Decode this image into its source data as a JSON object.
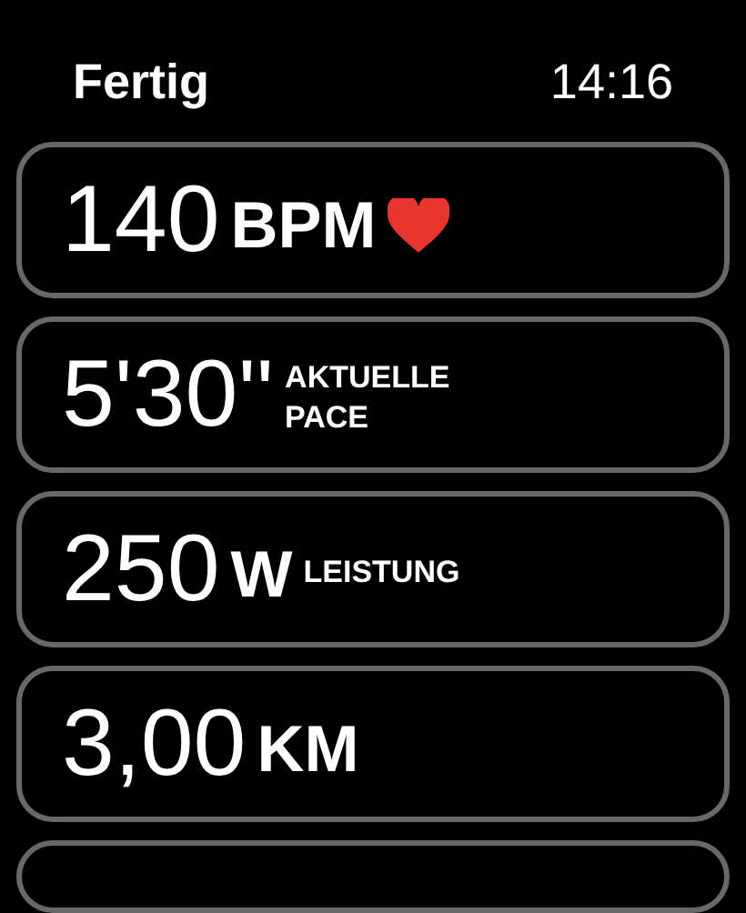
{
  "header": {
    "title": "Fertig",
    "time": "14:16"
  },
  "metrics": [
    {
      "kind": "heart",
      "value": "140",
      "unit": "BPM"
    },
    {
      "kind": "label",
      "value": "5'30''",
      "label": "AKTUELLE PACE"
    },
    {
      "kind": "label",
      "value": "250",
      "unit": "W",
      "label": "LEISTUNG"
    },
    {
      "kind": "plain",
      "value": "3,00",
      "unit": "KM"
    }
  ]
}
